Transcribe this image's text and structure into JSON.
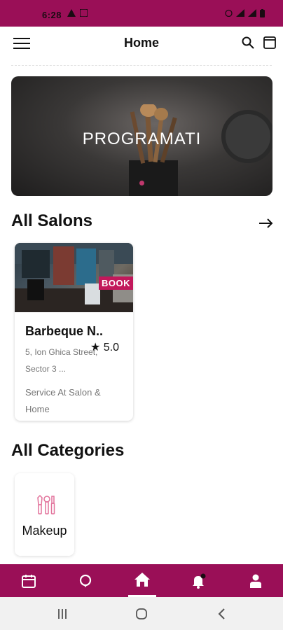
{
  "status_bar": {
    "time": "6:28"
  },
  "header": {
    "title": "Home"
  },
  "banner": {
    "text": "PROGRAMATI"
  },
  "salons_section": {
    "title": "All Salons"
  },
  "salon": {
    "name": "Barbeque N..",
    "rating": "★ 5.0",
    "address": "5, Ion Ghica Street, Sector 3 ...",
    "service": "Service At Salon & Home",
    "badge": "BOOK"
  },
  "categories_section": {
    "title": "All Categories"
  },
  "categories": [
    {
      "label": "Makeup",
      "icon": "makeup-brush-icon"
    }
  ],
  "bottom_nav": [
    {
      "name": "calendar-icon"
    },
    {
      "name": "location-icon"
    },
    {
      "name": "home-icon",
      "active": true
    },
    {
      "name": "notification-bell-icon"
    },
    {
      "name": "profile-icon"
    }
  ],
  "colors": {
    "primary": "#9a0f57",
    "badge": "#c2185b",
    "text": "#111111",
    "muted": "#777777"
  }
}
